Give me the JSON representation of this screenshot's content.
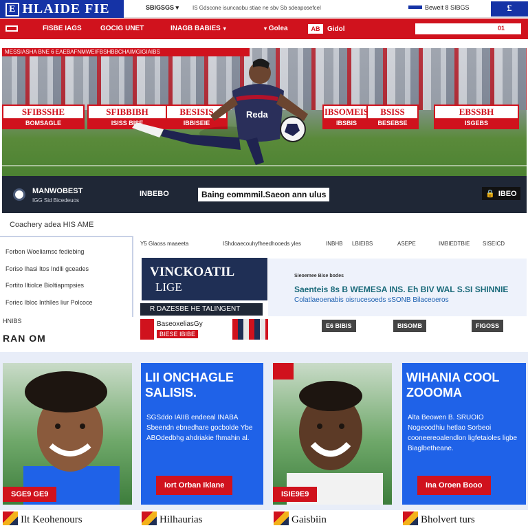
{
  "topbar": {
    "logo": "HLAIDE FIE",
    "logo_box": "E",
    "util_a": "SBIGSGS ▾",
    "util_b": "IS Gdscone isuncaobu stiae ne sbv Sb sdeaposefcel",
    "util_right": "Beweit  8  SIBGS",
    "util_btn": "£"
  },
  "nav": {
    "items": [
      "FISBE IAGS",
      "GOCIG UNET",
      "INAGB BABIES",
      "Golea",
      "Gidol"
    ],
    "box_label": "AB",
    "search_placeholder": "",
    "search_btn": "01"
  },
  "hero": {
    "tag": "MESSIASHA BNE 6 EAEBAFNMWEIFBSHBBCHAIMGIGIAIBS",
    "boards": [
      {
        "top": "SFIBSSHE",
        "bottom": "BOMSAGLE"
      },
      {
        "top": "SFIBBIBH",
        "bottom": "ISISS BISE"
      },
      {
        "top": "BESISIS",
        "bottom": "IBBISEIE"
      },
      {
        "top": "IBSOMEIS",
        "bottom": "IBSBIS"
      },
      {
        "top": "BSISS",
        "bottom": "BESEBSE"
      },
      {
        "top": "EBSSBH",
        "bottom": "ISGEBS"
      }
    ],
    "shirt_label": "Reda",
    "bar_title": "MANWOBEST",
    "bar_sub": "IGG Sid Bicedeuos",
    "bar_mid": "INBEBO",
    "caption": "Baing eommmil.Saeon ann ulus",
    "badge": "IBEO"
  },
  "crumb": "Coachery adea  HIS AME",
  "sidebar": {
    "items": [
      "Forbon Woeliarnsc fediebing",
      "Foriso Ihasi Itos Indlli gceades",
      "Fortito Iltiolce Bioltiapmpsies",
      "Foriec Ibloc Inthlles liur Polcoce"
    ],
    "heading": "HNIBS",
    "heading2": "RAN OM"
  },
  "filters": {
    "items": [
      "Y5 Glaoss maaeeta",
      "IShdoaecouhyfheedhooeds yles",
      "INBHB",
      "LBIEIBS",
      "ASEPE",
      "IMBIEDTBIE",
      "SISEICD"
    ]
  },
  "feature": {
    "title": "VINCKOATIL",
    "sub_title": "LIGE",
    "caption": "R DAZESBE HE TALINGENT"
  },
  "promo": {
    "kicker": "Sieoemee Bise bodes",
    "headline": "Saenteis 8s B WEMESA INS. Eh BIV WAL S.SI SHINNIE",
    "sub": "Colatlaeoenabis oisrucesoeds sSONB Bilaceoeros"
  },
  "mini": {
    "title": "BaseoxeliasGy",
    "tag": "BIESE IBIBE"
  },
  "tag_buttons": [
    "E6 BIBIS",
    "BISOMB",
    "FIGOSS"
  ],
  "cards": [
    {
      "caption": "SGE9 GE9"
    },
    {
      "heading": "LII ONCHAGLE SALISIS.",
      "body": "SGSddo IAIIB endeeal INABA Sbeendn ebnedhare gocbolde Ybe ABOdedbhg ahdriakie fhmahin al.",
      "button": "Iort Orban Iklane"
    },
    {
      "caption": "ISIE9E9"
    },
    {
      "heading": "WIHANIA COOL ZOOOMA",
      "body": "Alta Beowen B. SRUOIO Nogeoodhiu hetlao Sorbeoi cooneereoalendlon ligfetaioles ligbe Biaglbetheane.",
      "button": "Ina Oroen Booo"
    }
  ],
  "bottom": [
    "Ilt Keohenours",
    "Hilhaurias",
    "Gaisbiin",
    "Bholvert turs"
  ],
  "colors": {
    "brand_red": "#d0121d",
    "brand_blue": "#1533a6",
    "card_blue": "#1f62e8",
    "navy": "#1f2f55"
  }
}
